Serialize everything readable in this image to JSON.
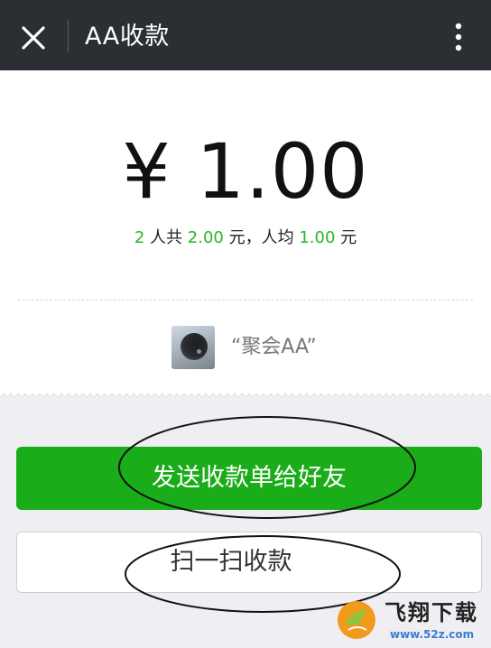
{
  "header": {
    "title": "AA收款",
    "close_icon": "close-icon",
    "more_icon": "more-vertical-icon"
  },
  "payment": {
    "amount": "¥ 1.00",
    "people_count": "2",
    "people_suffix": " 人共 ",
    "total": "2.00",
    "total_suffix": " 元，人均 ",
    "per_person": "1.00",
    "per_person_suffix": " 元"
  },
  "group": {
    "name": "“聚会AA”",
    "avatar_icon": "group-avatar"
  },
  "actions": {
    "send_label": "发送收款单给好友",
    "scan_label": "扫一扫收款"
  },
  "watermark": {
    "name": "飞翔下载",
    "url": "www.52z.com"
  },
  "colors": {
    "topbar": "#2b2e33",
    "accent_green": "#1aad19",
    "highlight_green": "#2bb52a",
    "background_grey": "#efeff3"
  }
}
